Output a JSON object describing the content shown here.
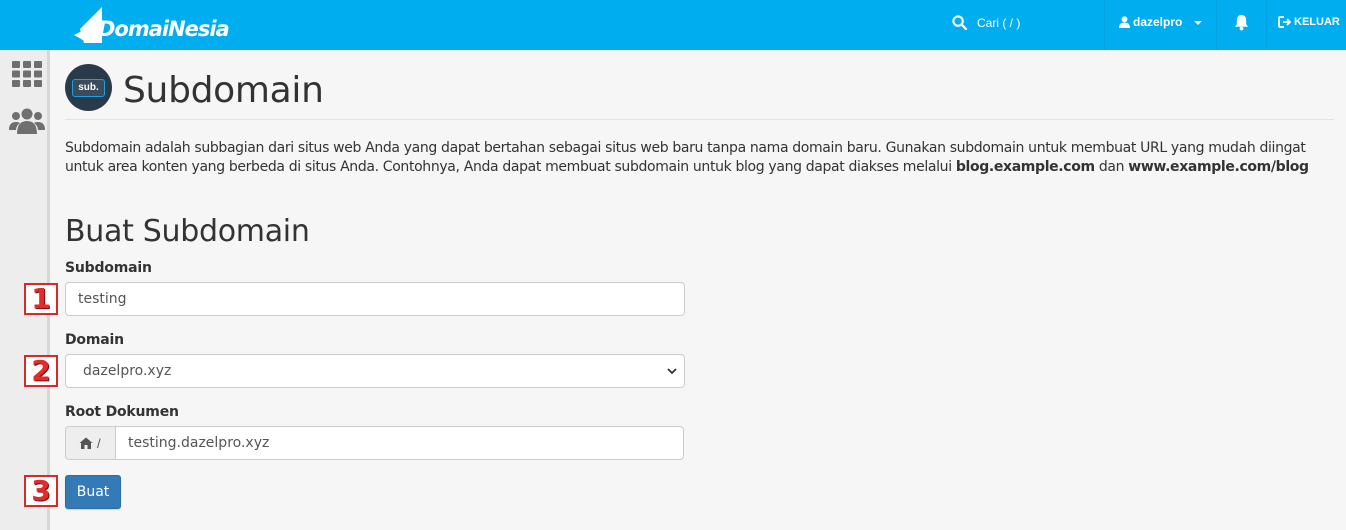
{
  "header": {
    "brand": "DomaiNesia",
    "search_placeholder": "Cari ( / )",
    "username": "dazelpro",
    "logout_label": "KELUAR"
  },
  "sidebar": {
    "items": [
      {
        "icon": "apps-grid-icon"
      },
      {
        "icon": "users-icon"
      }
    ]
  },
  "page": {
    "icon_text": "sub.",
    "title": "Subdomain",
    "description_part1": "Subdomain adalah subbagian dari situs web Anda yang dapat bertahan sebagai situs web baru tanpa nama domain baru. Gunakan subdomain untuk membuat URL yang mudah diingat untuk area konten yang berbeda di situs Anda. Contohnya, Anda dapat membuat subdomain untuk blog yang dapat diakses melalui ",
    "description_bold1": "blog.example.com",
    "description_and": " dan ",
    "description_bold2": "www.example.com/blog"
  },
  "form": {
    "section_title": "Buat Subdomain",
    "subdomain_label": "Subdomain",
    "subdomain_value": "testing",
    "domain_label": "Domain",
    "domain_value": "dazelpro.xyz",
    "docroot_label": "Root Dokumen",
    "docroot_prefix": "/",
    "docroot_value": "testing.dazelpro.xyz",
    "submit_label": "Buat"
  },
  "steps": [
    "1",
    "2",
    "3"
  ],
  "colors": {
    "topbar": "#00adee",
    "button": "#337ab7",
    "step_marker": "#e22b2b"
  }
}
